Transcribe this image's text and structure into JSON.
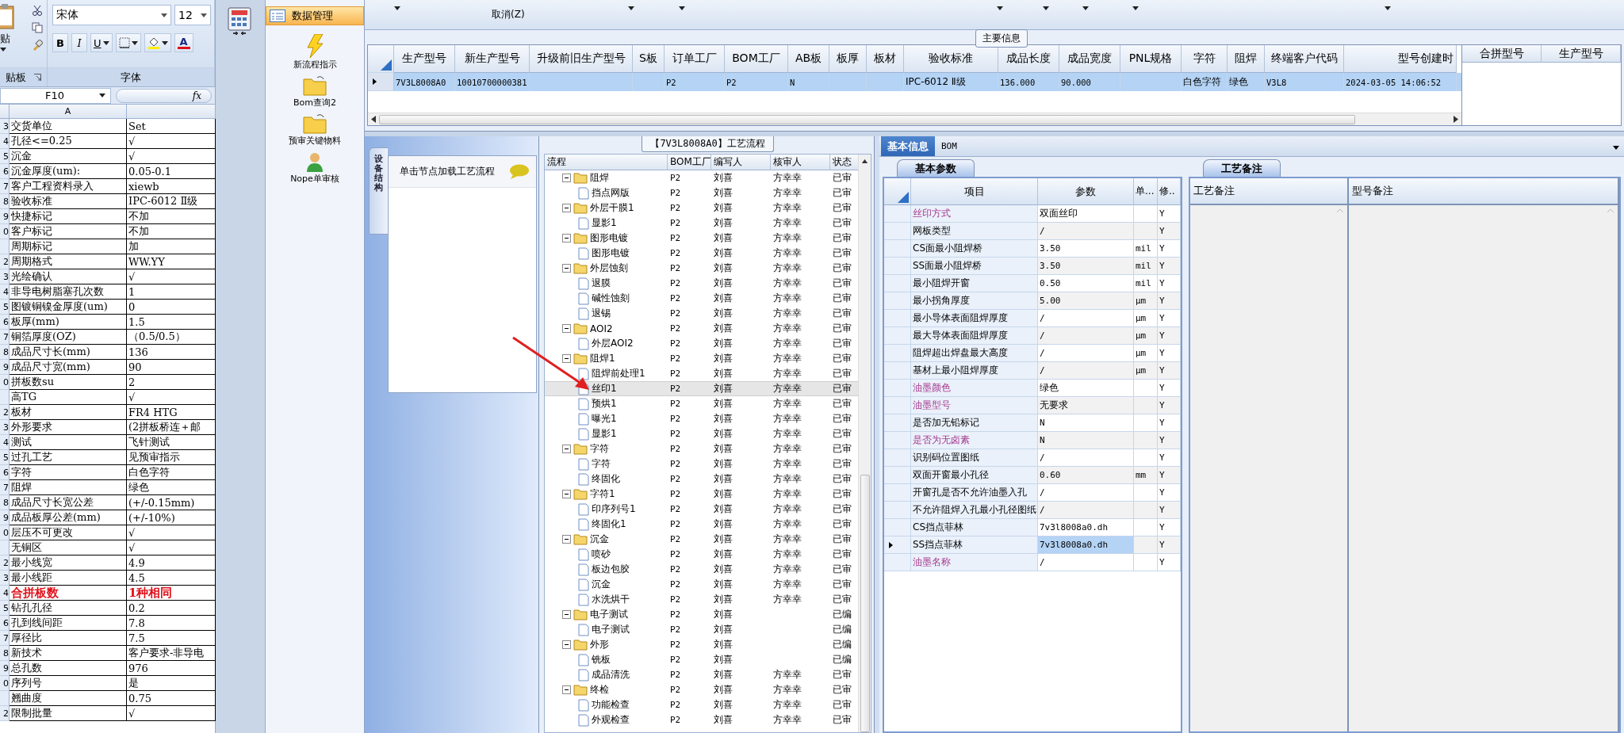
{
  "excel": {
    "ribbon": {
      "paste_label": "贴",
      "clipboard_group": "贴板",
      "font_name": "宋体",
      "font_size": "12",
      "bold": "B",
      "italic": "I",
      "underline": "U",
      "font_color": "A",
      "font_group": "字体"
    },
    "name_box": "F10",
    "fx": "fx",
    "column_a": "A",
    "rows": [
      {
        "num": "3",
        "label": "交货单位",
        "value": "Set",
        "emphasis": false
      },
      {
        "num": "4",
        "label": "孔径<=0.25",
        "value": "√",
        "emphasis": false
      },
      {
        "num": "5",
        "label": "沉金",
        "value": "√",
        "emphasis": false
      },
      {
        "num": "6",
        "label": "沉金厚度(um):",
        "value": "0.05-0.1",
        "emphasis": false
      },
      {
        "num": "7",
        "label": "客户工程资料录入",
        "value": "xiewb",
        "emphasis": false
      },
      {
        "num": "8",
        "label": "验收标准",
        "value": "IPC-6012 Ⅱ级",
        "emphasis": false
      },
      {
        "num": "9",
        "label": "快捷标记",
        "value": "不加",
        "emphasis": false
      },
      {
        "num": "0",
        "label": "客户标记",
        "value": "不加",
        "emphasis": false
      },
      {
        "label": "周期标记",
        "value": "加",
        "emphasis": false
      },
      {
        "num": "2",
        "label": "周期格式",
        "value": "WW.YY",
        "emphasis": false
      },
      {
        "num": "3",
        "label": "光绘确认",
        "value": "√",
        "emphasis": false
      },
      {
        "num": "4",
        "label": "非导电树脂塞孔次数",
        "value": "1",
        "emphasis": false
      },
      {
        "num": "5",
        "label": "图镀铜镍金厚度(um)",
        "value": "0",
        "emphasis": false
      },
      {
        "num": "6",
        "label": "板厚(mm)",
        "value": "1.5",
        "emphasis": false
      },
      {
        "num": "7",
        "label": "铜箔厚度(OZ)",
        "value": "（0.5/0.5）",
        "emphasis": false
      },
      {
        "num": "8",
        "label": "成品尺寸长(mm)",
        "value": "136",
        "emphasis": false
      },
      {
        "num": "9",
        "label": "成品尺寸宽(mm)",
        "value": "90",
        "emphasis": false
      },
      {
        "num": "0",
        "label": "拼板数su",
        "value": "2",
        "emphasis": false
      },
      {
        "label": "高TG",
        "value": "√",
        "emphasis": false
      },
      {
        "num": "2",
        "label": "板材",
        "value": "FR4 HTG",
        "emphasis": false
      },
      {
        "num": "3",
        "label": "外形要求",
        "value": "(2拼板桥连＋邮",
        "emphasis": false
      },
      {
        "num": "4",
        "label": "测试",
        "value": "飞针测试",
        "emphasis": false
      },
      {
        "num": "5",
        "label": "过孔工艺",
        "value": "见预审指示",
        "emphasis": false
      },
      {
        "num": "6",
        "label": "字符",
        "value": "白色字符",
        "emphasis": false
      },
      {
        "num": "7",
        "label": "阻焊",
        "value": "绿色",
        "emphasis": false
      },
      {
        "num": "8",
        "label": "成品尺寸长宽公差",
        "value": "(+/-0.15mm)",
        "emphasis": false
      },
      {
        "num": "9",
        "label": "成品板厚公差(mm)",
        "value": "(+/-10%)",
        "emphasis": false
      },
      {
        "num": "0",
        "label": "层压不可更改",
        "value": "√",
        "emphasis": false
      },
      {
        "label": "无铜区",
        "value": "√",
        "emphasis": false
      },
      {
        "num": "2",
        "label": "最小线宽",
        "value": "4.9",
        "emphasis": false
      },
      {
        "num": "3",
        "label": "最小线距",
        "value": "4.5",
        "emphasis": false
      },
      {
        "num": "4",
        "label": "合拼板数",
        "value": "1种相同",
        "emphasis": true
      },
      {
        "num": "5",
        "label": "钻孔孔径",
        "value": "0.2",
        "emphasis": false
      },
      {
        "num": "6",
        "label": "孔到线间距",
        "value": "7.8",
        "emphasis": false
      },
      {
        "num": "7",
        "label": "厚径比",
        "value": "7.5",
        "emphasis": false
      },
      {
        "num": "8",
        "label": "新技术",
        "value": "客户要求-非导电",
        "emphasis": false
      },
      {
        "num": "9",
        "label": "总孔数",
        "value": "976",
        "emphasis": false
      },
      {
        "num": "0",
        "label": "序列号",
        "value": "是",
        "emphasis": false
      },
      {
        "label": "翘曲度",
        "value": "0.75",
        "emphasis": false
      },
      {
        "num": "2",
        "label": "限制批量",
        "value": "√",
        "emphasis": false
      }
    ]
  },
  "nav": {
    "items": [
      {
        "label": "数据管理",
        "kind": "section",
        "selected": true
      },
      {
        "label": "新流程指示",
        "kind": "bolt",
        "selected": false
      },
      {
        "label": "Bom查询2",
        "kind": "folder",
        "selected": false
      },
      {
        "label": "预审关键物料",
        "kind": "folder",
        "selected": false
      },
      {
        "label": "Nope单审核",
        "kind": "person",
        "selected": false
      }
    ]
  },
  "toolbar": {
    "cancel": "取消(Z)"
  },
  "main_info": {
    "title": "主要信息",
    "row_selected": true,
    "columns": [
      {
        "label": "生产型号",
        "value": "7V3L8008A0"
      },
      {
        "label": "新生产型号",
        "value": "10010700000381"
      },
      {
        "label": "升级前旧生产型号"
      },
      {
        "label": "S板"
      },
      {
        "label": "订单工厂",
        "value": "P2"
      },
      {
        "label": "BOM工厂",
        "value": "P2"
      },
      {
        "label": "AB板",
        "value": "N"
      },
      {
        "label": "板厚"
      },
      {
        "label": "板材"
      },
      {
        "label": "验收标准",
        "value": "IPC-6012 Ⅱ级"
      },
      {
        "label": "成品长度",
        "value": "136.000"
      },
      {
        "label": "成品宽度",
        "value": "90.000"
      },
      {
        "label": "PNL规格"
      },
      {
        "label": "字符",
        "value": "白色字符"
      },
      {
        "label": "阻焊",
        "value": "绿色"
      },
      {
        "label": "终端客户代码",
        "value": "V3L8"
      },
      {
        "label": "型号创建时",
        "value": "2024-03-05 14:06:52"
      }
    ],
    "merge_columns": [
      "合拼型号",
      "生产型号"
    ]
  },
  "left_pane": {
    "tab": "设备结构",
    "hint": "单击节点加载工艺流程"
  },
  "tree": {
    "title": "【7V3L8008A0】工艺流程",
    "columns": [
      "流程",
      "BOM工厂",
      "编写人",
      "核审人",
      "状态"
    ],
    "rows": [
      {
        "label": "阻焊",
        "bom": "P2",
        "writer": "刘喜",
        "reviewer": "方幸幸",
        "status": "已审",
        "expanded": true,
        "selected": false,
        "children": [
          {
            "label": "挡点网版",
            "bom": "P2",
            "writer": "刘喜",
            "reviewer": "方幸幸",
            "status": "已审",
            "selected": false
          }
        ]
      },
      {
        "label": "外层干膜1",
        "bom": "P2",
        "writer": "刘喜",
        "reviewer": "方幸幸",
        "status": "已审",
        "expanded": true,
        "selected": false,
        "children": [
          {
            "label": "显影1",
            "bom": "P2",
            "writer": "刘喜",
            "reviewer": "方幸幸",
            "status": "已审",
            "selected": false
          }
        ]
      },
      {
        "label": "图形电镀",
        "bom": "P2",
        "writer": "刘喜",
        "reviewer": "方幸幸",
        "status": "已审",
        "expanded": true,
        "selected": false,
        "children": [
          {
            "label": "图形电镀",
            "bom": "P2",
            "writer": "刘喜",
            "reviewer": "方幸幸",
            "status": "已审",
            "selected": false
          }
        ]
      },
      {
        "label": "外层蚀刻",
        "bom": "P2",
        "writer": "刘喜",
        "reviewer": "方幸幸",
        "status": "已审",
        "expanded": true,
        "selected": false,
        "children": [
          {
            "label": "退膜",
            "bom": "P2",
            "writer": "刘喜",
            "reviewer": "方幸幸",
            "status": "已审",
            "selected": false
          },
          {
            "label": "碱性蚀刻",
            "bom": "P2",
            "writer": "刘喜",
            "reviewer": "方幸幸",
            "status": "已审",
            "selected": false
          },
          {
            "label": "退锡",
            "bom": "P2",
            "writer": "刘喜",
            "reviewer": "方幸幸",
            "status": "已审",
            "selected": false
          }
        ]
      },
      {
        "label": "AOI2",
        "bom": "P2",
        "writer": "刘喜",
        "reviewer": "方幸幸",
        "status": "已审",
        "expanded": true,
        "selected": false,
        "children": [
          {
            "label": "外层AOI2",
            "bom": "P2",
            "writer": "刘喜",
            "reviewer": "方幸幸",
            "status": "已审",
            "selected": false
          }
        ]
      },
      {
        "label": "阻焊1",
        "bom": "P2",
        "writer": "刘喜",
        "reviewer": "方幸幸",
        "status": "已审",
        "expanded": true,
        "selected": false,
        "children": [
          {
            "label": "阻焊前处理1",
            "bom": "P2",
            "writer": "刘喜",
            "reviewer": "方幸幸",
            "status": "已审",
            "selected": false
          },
          {
            "label": "丝印1",
            "bom": "P2",
            "writer": "刘喜",
            "reviewer": "方幸幸",
            "status": "已审",
            "selected": true
          },
          {
            "label": "预烘1",
            "bom": "P2",
            "writer": "刘喜",
            "reviewer": "方幸幸",
            "status": "已审",
            "selected": false
          },
          {
            "label": "曝光1",
            "bom": "P2",
            "writer": "刘喜",
            "reviewer": "方幸幸",
            "status": "已审",
            "selected": false
          },
          {
            "label": "显影1",
            "bom": "P2",
            "writer": "刘喜",
            "reviewer": "方幸幸",
            "status": "已审",
            "selected": false
          }
        ]
      },
      {
        "label": "字符",
        "bom": "P2",
        "writer": "刘喜",
        "reviewer": "方幸幸",
        "status": "已审",
        "expanded": true,
        "selected": false,
        "children": [
          {
            "label": "字符",
            "bom": "P2",
            "writer": "刘喜",
            "reviewer": "方幸幸",
            "status": "已审",
            "selected": false
          },
          {
            "label": "终固化",
            "bom": "P2",
            "writer": "刘喜",
            "reviewer": "方幸幸",
            "status": "已审",
            "selected": false
          }
        ]
      },
      {
        "label": "字符1",
        "bom": "P2",
        "writer": "刘喜",
        "reviewer": "方幸幸",
        "status": "已审",
        "expanded": true,
        "selected": false,
        "children": [
          {
            "label": "印序列号1",
            "bom": "P2",
            "writer": "刘喜",
            "reviewer": "方幸幸",
            "status": "已审",
            "selected": false
          },
          {
            "label": "终固化1",
            "bom": "P2",
            "writer": "刘喜",
            "reviewer": "方幸幸",
            "status": "已审",
            "selected": false
          }
        ]
      },
      {
        "label": "沉金",
        "bom": "P2",
        "writer": "刘喜",
        "reviewer": "方幸幸",
        "status": "已审",
        "expanded": true,
        "selected": false,
        "children": [
          {
            "label": "喷砂",
            "bom": "P2",
            "writer": "刘喜",
            "reviewer": "方幸幸",
            "status": "已审",
            "selected": false
          },
          {
            "label": "板边包胶",
            "bom": "P2",
            "writer": "刘喜",
            "reviewer": "方幸幸",
            "status": "已审",
            "selected": false
          },
          {
            "label": "沉金",
            "bom": "P2",
            "writer": "刘喜",
            "reviewer": "方幸幸",
            "status": "已审",
            "selected": false
          },
          {
            "label": "水洗烘干",
            "bom": "P2",
            "writer": "刘喜",
            "reviewer": "方幸幸",
            "status": "已审",
            "selected": false
          }
        ]
      },
      {
        "label": "电子测试",
        "bom": "P2",
        "writer": "刘喜",
        "status": "已编",
        "expanded": true,
        "selected": false,
        "children": [
          {
            "label": "电子测试",
            "bom": "P2",
            "writer": "刘喜",
            "status": "已编",
            "selected": false
          }
        ]
      },
      {
        "label": "外形",
        "bom": "P2",
        "writer": "刘喜",
        "status": "已编",
        "expanded": true,
        "selected": false,
        "children": [
          {
            "label": "铣板",
            "bom": "P2",
            "writer": "刘喜",
            "status": "已编",
            "selected": false
          },
          {
            "label": "成品清洗",
            "bom": "P2",
            "writer": "刘喜",
            "reviewer": "方幸幸",
            "status": "已审",
            "selected": false
          }
        ]
      },
      {
        "label": "终检",
        "bom": "P2",
        "writer": "刘喜",
        "reviewer": "方幸幸",
        "status": "已审",
        "expanded": true,
        "selected": false,
        "children": [
          {
            "label": "功能检查",
            "bom": "P2",
            "writer": "刘喜",
            "reviewer": "方幸幸",
            "status": "已审",
            "selected": false
          },
          {
            "label": "外观检查",
            "bom": "P2",
            "writer": "刘喜",
            "reviewer": "方幸幸",
            "status": "已审",
            "selected": false
          }
        ]
      }
    ]
  },
  "detail_tabs": [
    {
      "label": "基本信息",
      "selected": true
    },
    {
      "label": "BOM",
      "selected": false
    }
  ],
  "params": {
    "tab": "基本参数",
    "columns": [
      "项目",
      "参数",
      "单...",
      "修.."
    ],
    "rows": [
      {
        "label": "丝印方式",
        "value": "双面丝印",
        "flag": "Y",
        "highlighted": true,
        "selected": false
      },
      {
        "label": "网板类型",
        "value": "/",
        "flag": "Y",
        "highlighted": false,
        "selected": false
      },
      {
        "label": "CS面最小阻焊桥",
        "value": "3.50",
        "unit": "mil",
        "flag": "Y",
        "highlighted": false,
        "selected": false
      },
      {
        "label": "SS面最小阻焊桥",
        "value": "3.50",
        "unit": "mil",
        "flag": "Y",
        "highlighted": false,
        "selected": false
      },
      {
        "label": "最小阻焊开窗",
        "value": "0.50",
        "unit": "mil",
        "flag": "Y",
        "highlighted": false,
        "selected": false
      },
      {
        "label": "最小拐角厚度",
        "value": "5.00",
        "unit": "μm",
        "flag": "Y",
        "highlighted": false,
        "selected": false
      },
      {
        "label": "最小导体表面阻焊厚度",
        "value": "/",
        "unit": "μm",
        "flag": "Y",
        "highlighted": false,
        "selected": false
      },
      {
        "label": "最大导体表面阻焊厚度",
        "value": "/",
        "unit": "μm",
        "flag": "Y",
        "highlighted": false,
        "selected": false
      },
      {
        "label": "阻焊超出焊盘最大高度",
        "value": "/",
        "unit": "μm",
        "flag": "Y",
        "highlighted": false,
        "selected": false
      },
      {
        "label": "基材上最小阻焊厚度",
        "value": "/",
        "unit": "μm",
        "flag": "Y",
        "highlighted": false,
        "selected": false
      },
      {
        "label": "油墨颜色",
        "value": "绿色",
        "flag": "Y",
        "highlighted": true,
        "selected": false
      },
      {
        "label": "油墨型号",
        "value": "无要求",
        "flag": "Y",
        "highlighted": true,
        "selected": false
      },
      {
        "label": "是否加无铅标记",
        "value": "N",
        "flag": "Y",
        "highlighted": false,
        "selected": false
      },
      {
        "label": "是否为无卤素",
        "value": "N",
        "flag": "Y",
        "highlighted": true,
        "selected": false
      },
      {
        "label": "识别码位置图纸",
        "value": "/",
        "flag": "Y",
        "highlighted": false,
        "selected": false
      },
      {
        "label": "双面开窗最小孔径",
        "value": "0.60",
        "unit": "mm",
        "flag": "Y",
        "highlighted": false,
        "selected": false
      },
      {
        "label": "开窗孔是否不允许油墨入孔",
        "value": "/",
        "flag": "Y",
        "highlighted": false,
        "selected": false
      },
      {
        "label": "不允许阻焊入孔最小孔径图纸",
        "value": "/",
        "flag": "Y",
        "highlighted": false,
        "selected": false
      },
      {
        "label": "CS挡点菲林",
        "value": "7v3l8008a0.dh",
        "flag": "Y",
        "highlighted": false,
        "selected": false
      },
      {
        "label": "SS挡点菲林",
        "value": "7v3l8008a0.dh",
        "flag": "Y",
        "highlighted": false,
        "selected": true
      },
      {
        "label": "油墨名称",
        "value": "/",
        "flag": "Y",
        "highlighted": true,
        "selected": false
      }
    ]
  },
  "notes": {
    "tab": "工艺备注",
    "columns": [
      "工艺备注",
      "型号备注"
    ]
  }
}
